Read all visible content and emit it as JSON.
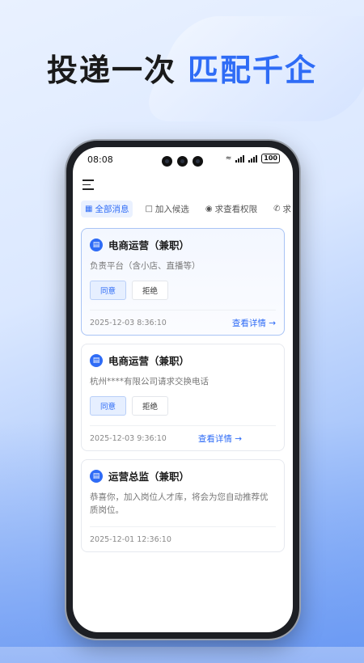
{
  "headline": {
    "main": "投递一次",
    "accent": "匹配千企"
  },
  "status_bar": {
    "time": "08:08",
    "battery": "100"
  },
  "tabs": [
    {
      "label": "全部消息",
      "icon": "grid-icon",
      "active": true
    },
    {
      "label": "加入候选",
      "icon": "doc-icon",
      "active": false
    },
    {
      "label": "求查看权限",
      "icon": "eye-icon",
      "active": false
    },
    {
      "label": "求",
      "icon": "phone-icon",
      "active": false
    }
  ],
  "messages": [
    {
      "title": "电商运营（兼职）",
      "desc": "负责平台（含小店、直播等）",
      "agree": "同意",
      "reject": "拒绝",
      "time": "2025-12-03 8:36:10",
      "detail": "查看详情 →"
    },
    {
      "title": "电商运营（兼职）",
      "desc": "杭州****有限公司请求交换电话",
      "agree": "同意",
      "reject": "拒绝",
      "time": "2025-12-03 9:36:10",
      "detail": "查看详情 →"
    },
    {
      "title": "运营总监（兼职）",
      "desc": "恭喜你，加入岗位人才库，将会为您自动推荐优质岗位。",
      "time": "2025-12-01 12:36:10"
    }
  ],
  "colors": {
    "accent": "#2f6cf6"
  }
}
